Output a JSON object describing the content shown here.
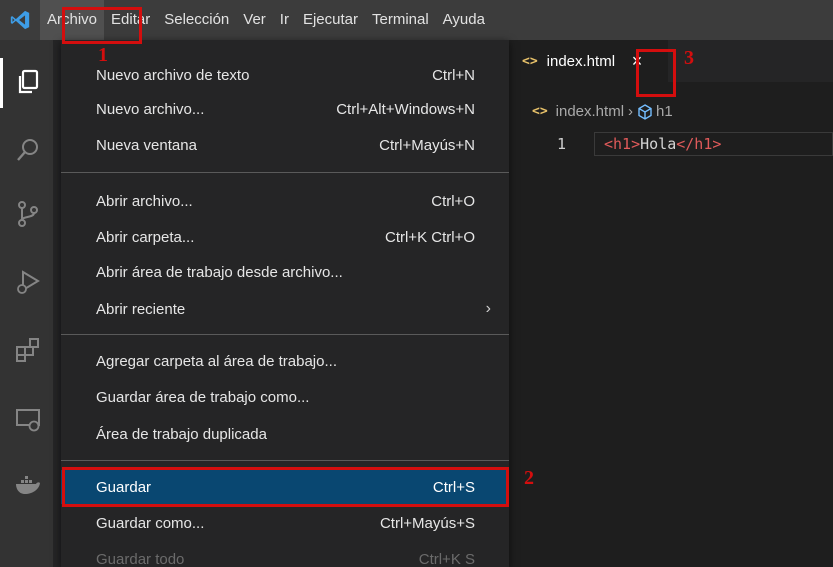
{
  "menubar": {
    "items": [
      "Archivo",
      "Editar",
      "Selección",
      "Ver",
      "Ir",
      "Ejecutar",
      "Terminal",
      "Ayuda"
    ]
  },
  "file_menu": {
    "items": [
      {
        "label": "Nuevo archivo de texto",
        "shortcut": "Ctrl+N"
      },
      {
        "label": "Nuevo archivo...",
        "shortcut": "Ctrl+Alt+Windows+N"
      },
      {
        "label": "Nueva ventana",
        "shortcut": "Ctrl+Mayús+N"
      },
      {
        "label": "Abrir archivo...",
        "shortcut": "Ctrl+O"
      },
      {
        "label": "Abrir carpeta...",
        "shortcut": "Ctrl+K Ctrl+O"
      },
      {
        "label": "Abrir área de trabajo desde archivo...",
        "shortcut": ""
      },
      {
        "label": "Abrir reciente",
        "shortcut": "›"
      },
      {
        "label": "Agregar carpeta al área de trabajo...",
        "shortcut": ""
      },
      {
        "label": "Guardar área de trabajo como...",
        "shortcut": ""
      },
      {
        "label": "Área de trabajo duplicada",
        "shortcut": ""
      },
      {
        "label": "Guardar",
        "shortcut": "Ctrl+S"
      },
      {
        "label": "Guardar como...",
        "shortcut": "Ctrl+Mayús+S"
      },
      {
        "label": "Guardar todo",
        "shortcut": "Ctrl+K S"
      }
    ]
  },
  "editor": {
    "tab_label": "index.html",
    "tab_close": "×",
    "file_icon": "<>",
    "breadcrumb": {
      "file": "index.html",
      "separator": "›",
      "symbol": "h1"
    },
    "line_number": "1",
    "code": {
      "open_tag": "<h1>",
      "text": "Hola",
      "close_tag": "</h1>"
    }
  },
  "annotations": {
    "one": "1",
    "two": "2",
    "three": "3"
  },
  "colors": {
    "accent_annotation": "#d40e0e",
    "selection": "#094771",
    "menubar": "#3c3c3c"
  }
}
